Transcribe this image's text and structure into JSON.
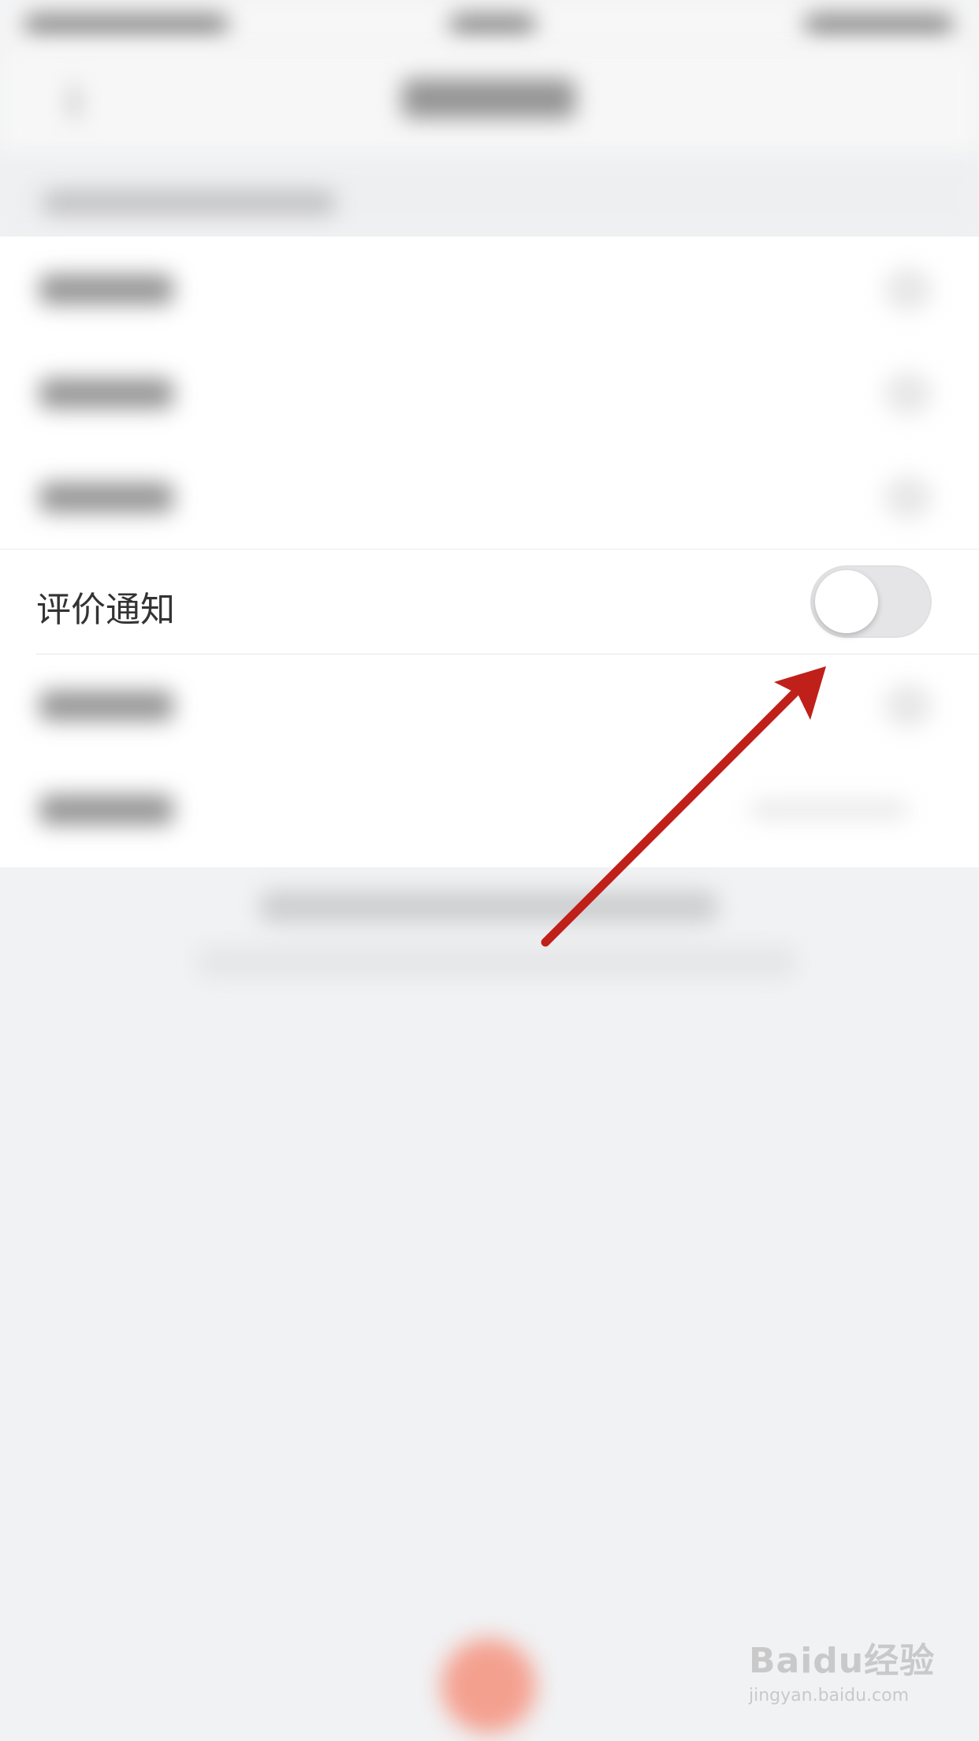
{
  "settings": {
    "review_notification": {
      "label": "评价通知",
      "enabled": false
    }
  },
  "watermark": {
    "logo": "Baidu经验",
    "url": "jingyan.baidu.com"
  },
  "colors": {
    "annotation_arrow": "#c0201a",
    "toggle_off": "#e5e5e7",
    "fab": "#f4a08f",
    "background": "#f1f2f4"
  }
}
